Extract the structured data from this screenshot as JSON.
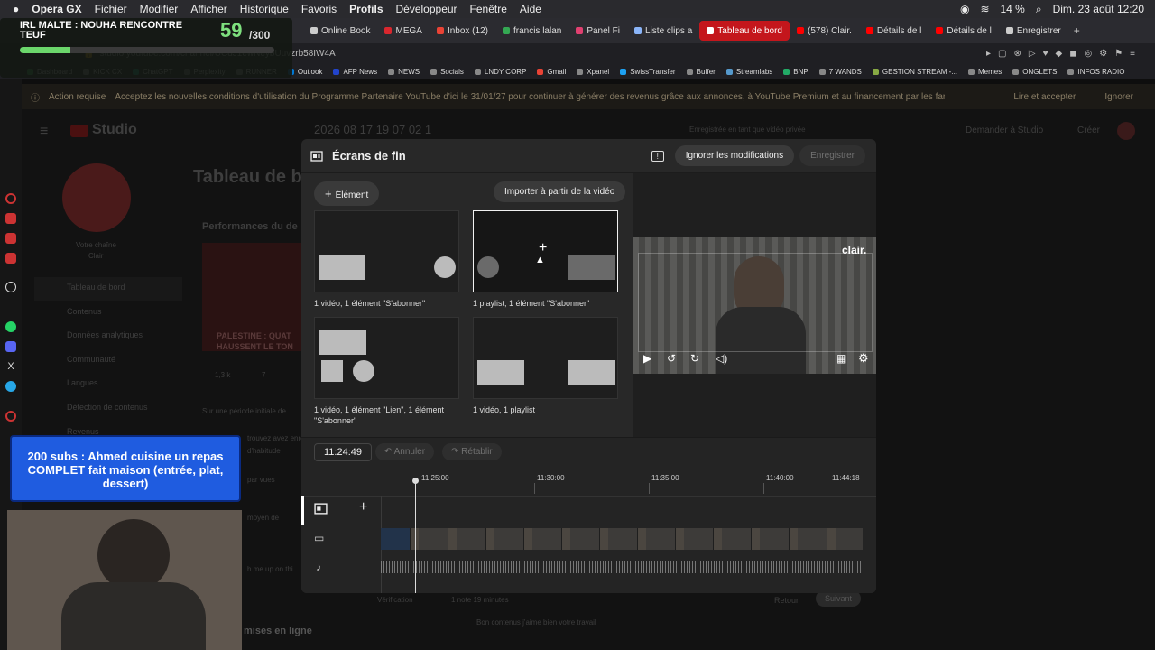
{
  "menubar": {
    "apple": "",
    "app": "Opera GX",
    "items": [
      "Fichier",
      "Modifier",
      "Afficher",
      "Historique",
      "Favoris",
      "Profils",
      "Développeur",
      "Fenêtre",
      "Aide"
    ],
    "battery": "14 %",
    "datetime": "Dim. 23 août  12:20"
  },
  "tabs": [
    {
      "label": "Online Book",
      "color": "#ccc"
    },
    {
      "label": "MEGA",
      "color": "#d9272e"
    },
    {
      "label": "Inbox (12)",
      "color": "#ea4335"
    },
    {
      "label": "francis lalan",
      "color": "#34a853"
    },
    {
      "label": "Panel Fi",
      "color": "#e04070"
    },
    {
      "label": "Liste clips a",
      "color": "#8ab4f8"
    },
    {
      "label": "Tableau de bord",
      "color": "#ff0000",
      "active": true
    },
    {
      "label": "(578) Clair.",
      "color": "#ff0000"
    },
    {
      "label": "Détails de l",
      "color": "#ff0000"
    },
    {
      "label": "Détails de l",
      "color": "#ff0000"
    },
    {
      "label": "Enregistrer",
      "color": "#ccc"
    }
  ],
  "address": "studio.youtube.com/channel/UCdJ1ewNeybUuvzrb58IW4A",
  "bookmarks": [
    "Dashboard",
    "KICK CX",
    "ChatGPT",
    "Perplexity",
    "RUNNER",
    "Outlook",
    "AFP News",
    "NEWS",
    "Socials",
    "LNDY CORP",
    "Gmail",
    "Xpanel",
    "SwissTransfer",
    "Buffer",
    "Streamlabs",
    "BNP",
    "7 WANDS",
    "GESTION STREAM -...",
    "Memes",
    "ONGLETS",
    "INFOS RADIO"
  ],
  "banner": {
    "label": "Action requise",
    "text": "Acceptez les nouvelles conditions d'utilisation du Programme Partenaire YouTube d'ici le 31/01/27 pour continuer à générer des revenus grâce aux annonces, à YouTube Premium et au financement par les fans",
    "accept": "Lire et accepter",
    "ignore": "Ignorer"
  },
  "studio": {
    "brand": "Studio",
    "video_title": "2026 08 17 19 07 02 1",
    "saved": "Enregistrée en tant que vidéo privée",
    "ask": "Demander à Studio",
    "create": "Créer",
    "page_title": "Tableau de bord",
    "channel_label": "Votre chaîne",
    "channel_name": "Clair",
    "nav": [
      "Tableau de bord",
      "Contenus",
      "Données analytiques",
      "Communauté",
      "Langues",
      "Détection de contenus",
      "Revenus"
    ],
    "perf": "Performances du de",
    "video_card": "PALESTINE : QUAT HAUSSENT LE TON",
    "stat1": "1,3 k",
    "stat2": "7",
    "period": "Sur une période initiale de",
    "s1": "trouvez avez enreg",
    "s2": "d'habitude",
    "s3": "par vues",
    "s4": "moyen de",
    "s5": "h me up on thi",
    "online": "mises en ligne",
    "verif": "Vérification",
    "remaining": "1 note 19 minutes",
    "back": "Retour",
    "next": "Suivant",
    "comment": "Bon contenus j'aime bien votre travail"
  },
  "overlay": {
    "title": "IRL MALTE : NOUHA RENCONTRE TEUF",
    "count": "59",
    "goal": "/300",
    "progress_pct": 19.7
  },
  "subs": {
    "text": "200 subs : Ahmed cuisine un repas COMPLET fait maison (entrée, plat, dessert)"
  },
  "modal": {
    "title": "Écrans de fin",
    "discard": "Ignorer les modifications",
    "save": "Enregistrer",
    "add_element": "Élément",
    "import": "Importer à partir de la vidéo",
    "templates": [
      {
        "caption": "1 vidéo, 1 élément \"S'abonner\""
      },
      {
        "caption": "1 playlist, 1 élément \"S'abonner\""
      },
      {
        "caption": "1 vidéo, 1 élément \"Lien\", 1 élément \"S'abonner\""
      },
      {
        "caption": "1 vidéo, 1 playlist"
      }
    ],
    "preview_logo": "clair.",
    "timecode": "11:24:49",
    "undo": "Annuler",
    "redo": "Rétablir",
    "ticks": [
      "11:25:00",
      "11:30:00",
      "11:35:00",
      "11:40:00",
      "11:44:18"
    ]
  }
}
